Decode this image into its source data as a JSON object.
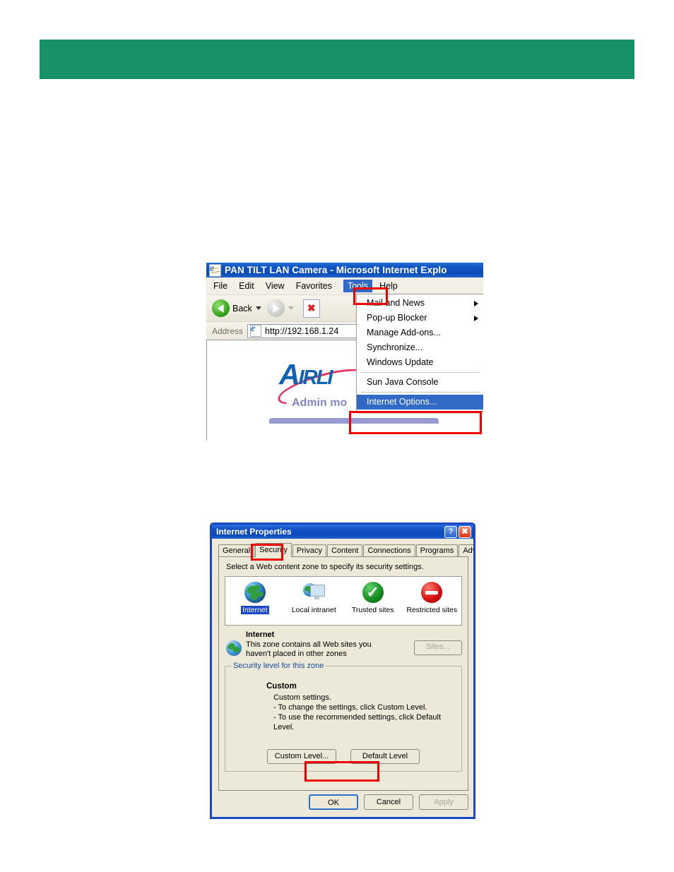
{
  "banner": {
    "color": "#18906a"
  },
  "browser": {
    "title": "PAN TILT LAN Camera - Microsoft Internet Explo",
    "menu": [
      {
        "label": "File"
      },
      {
        "label": "Edit"
      },
      {
        "label": "View"
      },
      {
        "label": "Favorites"
      },
      {
        "label": "Tools"
      },
      {
        "label": "Help"
      }
    ],
    "toolbar": {
      "back_label": "Back"
    },
    "address": {
      "label": "Address",
      "value": "http://192.168.1.24"
    },
    "page": {
      "logo_text_a": "A",
      "logo_text_rest": "IRLI",
      "admin_mode": "Admin mo"
    },
    "tools_menu": {
      "items": [
        {
          "label": "Mail and News",
          "submenu": true,
          "selected": false
        },
        {
          "label": "Pop-up Blocker",
          "submenu": true,
          "selected": false
        },
        {
          "label": "Manage Add-ons...",
          "submenu": false,
          "selected": false
        },
        {
          "label": "Synchronize...",
          "submenu": false,
          "selected": false
        },
        {
          "label": "Windows Update",
          "submenu": false,
          "selected": false
        },
        {
          "label": "Sun Java Console",
          "submenu": false,
          "selected": false
        },
        {
          "label": "Internet Options...",
          "submenu": false,
          "selected": true
        }
      ]
    }
  },
  "dialog": {
    "title": "Internet Properties",
    "titlebar_buttons": {
      "help": "?",
      "close": "✖"
    },
    "tabs": [
      {
        "label": "General",
        "active": false
      },
      {
        "label": "Security",
        "active": true
      },
      {
        "label": "Privacy",
        "active": false
      },
      {
        "label": "Content",
        "active": false
      },
      {
        "label": "Connections",
        "active": false
      },
      {
        "label": "Programs",
        "active": false
      },
      {
        "label": "Advanced",
        "active": false
      }
    ],
    "lead_text": "Select a Web content zone to specify its security settings.",
    "zones": [
      {
        "label": "Internet",
        "icon": "globe-icon",
        "selected": true
      },
      {
        "label": "Local intranet",
        "icon": "intranet-icon",
        "selected": false
      },
      {
        "label": "Trusted sites",
        "icon": "trusted-check-icon",
        "selected": false
      },
      {
        "label": "Restricted sites",
        "icon": "restricted-deny-icon",
        "selected": false
      }
    ],
    "zone_detail": {
      "name": "Internet",
      "description_line1": "This zone contains all Web sites you",
      "description_line2": "haven't placed in other zones",
      "sites_button": "Sites..."
    },
    "security_level": {
      "legend": "Security level for this zone",
      "level_name": "Custom",
      "line1": "Custom settings.",
      "line2": "- To change the settings, click Custom Level.",
      "line3": "- To use the recommended settings, click Default Level.",
      "custom_level_button": "Custom Level...",
      "default_level_button": "Default Level"
    },
    "footer": {
      "ok": "OK",
      "cancel": "Cancel",
      "apply": "Apply"
    }
  },
  "highlights": {
    "color": "#ee0000",
    "items": [
      {
        "name": "tools-menu-highlight"
      },
      {
        "name": "internet-options-highlight"
      },
      {
        "name": "security-tab-highlight"
      },
      {
        "name": "custom-level-highlight"
      }
    ]
  }
}
